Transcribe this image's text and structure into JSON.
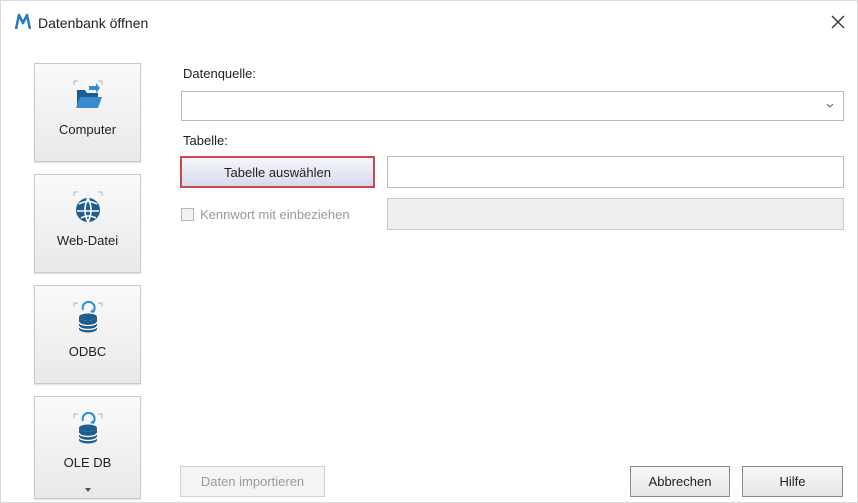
{
  "window": {
    "title": "Datenbank öffnen",
    "close_symbol": "✕"
  },
  "sources": [
    {
      "label": "Computer",
      "icon": "folder-open-icon"
    },
    {
      "label": "Web-Datei",
      "icon": "globe-icon"
    },
    {
      "label": "ODBC",
      "icon": "database-icon"
    },
    {
      "label": "OLE DB",
      "icon": "database-icon"
    }
  ],
  "form": {
    "datasource_label": "Datenquelle:",
    "datasource_value": "",
    "table_label": "Tabelle:",
    "select_table_button": "Tabelle auswählen",
    "table_value": "",
    "password_checkbox_label": "Kennwort mit einbeziehen",
    "password_checked": false
  },
  "footer": {
    "import_button": "Daten importieren",
    "cancel_button": "Abbrechen",
    "help_button": "Hilfe"
  },
  "colors": {
    "accent_blue": "#1f6fb5",
    "selected_border": "#c94a4e"
  }
}
